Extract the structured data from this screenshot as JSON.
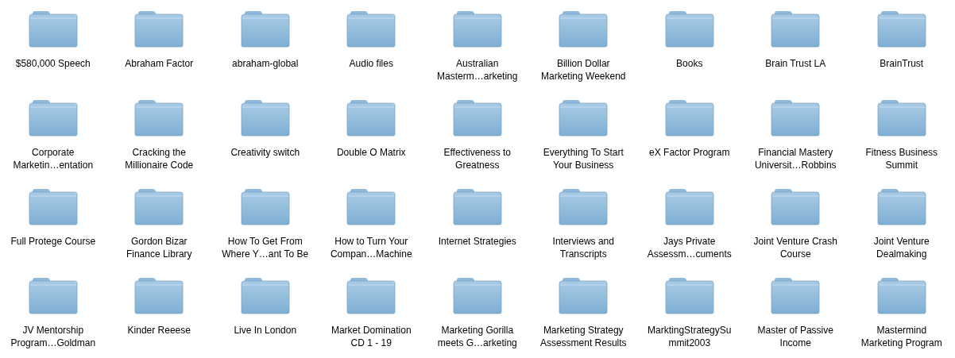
{
  "folders": [
    {
      "lines": [
        "$580,000 Speech"
      ]
    },
    {
      "lines": [
        "Abraham Factor"
      ]
    },
    {
      "lines": [
        "abraham-global"
      ]
    },
    {
      "lines": [
        "Audio files"
      ]
    },
    {
      "lines": [
        "Australian",
        "Masterm…arketing"
      ]
    },
    {
      "lines": [
        "Billion Dollar",
        "Marketing Weekend"
      ]
    },
    {
      "lines": [
        "Books"
      ]
    },
    {
      "lines": [
        "Brain Trust LA"
      ]
    },
    {
      "lines": [
        "BrainTrust"
      ]
    },
    {
      "lines": [
        "Corporate",
        "Marketin…entation"
      ]
    },
    {
      "lines": [
        "Cracking the",
        "Millionaire Code"
      ]
    },
    {
      "lines": [
        "Creativity switch"
      ]
    },
    {
      "lines": [
        "Double O Matrix"
      ]
    },
    {
      "lines": [
        "Effectiveness to",
        "Greatness"
      ]
    },
    {
      "lines": [
        "Everything To Start",
        "Your Business"
      ]
    },
    {
      "lines": [
        "eX Factor Program"
      ]
    },
    {
      "lines": [
        "Financial Mastery",
        "Universit…Robbins"
      ]
    },
    {
      "lines": [
        "Fitness Business",
        "Summit"
      ]
    },
    {
      "lines": [
        "Full Protege Course"
      ]
    },
    {
      "lines": [
        "Gordon Bizar",
        "Finance Library"
      ]
    },
    {
      "lines": [
        "How To Get From",
        "Where Y…ant To Be"
      ]
    },
    {
      "lines": [
        "How to Turn Your",
        "Compan…Machine"
      ]
    },
    {
      "lines": [
        "Internet Strategies"
      ]
    },
    {
      "lines": [
        "Interviews and",
        "Transcripts"
      ]
    },
    {
      "lines": [
        "Jays Private",
        "Assessm…cuments"
      ]
    },
    {
      "lines": [
        "Joint Venture Crash",
        "Course"
      ]
    },
    {
      "lines": [
        "Joint Venture",
        "Dealmaking"
      ]
    },
    {
      "lines": [
        "JV Mentorship",
        "Program…Goldman"
      ]
    },
    {
      "lines": [
        "Kinder Reeese"
      ]
    },
    {
      "lines": [
        "Live In London"
      ]
    },
    {
      "lines": [
        "Market Domination",
        "CD 1 - 19"
      ]
    },
    {
      "lines": [
        "Marketing Gorilla",
        "meets G…arketing"
      ]
    },
    {
      "lines": [
        "Marketing Strategy",
        "Assessment Results"
      ]
    },
    {
      "lines": [
        "MarktingStrategySu",
        "mmit2003"
      ]
    },
    {
      "lines": [
        "Master of Passive",
        "Income"
      ]
    },
    {
      "lines": [
        "Mastermind",
        "Marketing Program"
      ]
    }
  ]
}
